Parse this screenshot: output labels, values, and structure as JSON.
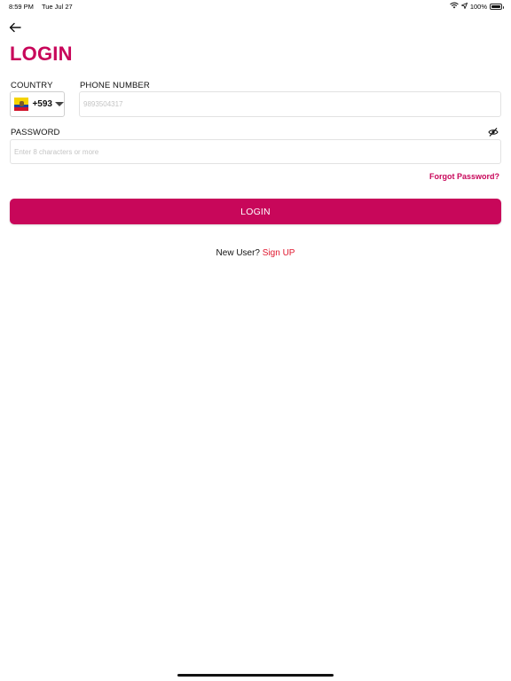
{
  "status_bar": {
    "time": "8:59 PM",
    "date": "Tue Jul 27",
    "battery_text": "100%",
    "battery_level": 1.0,
    "icons": [
      "wifi-icon",
      "location-icon",
      "battery-icon"
    ]
  },
  "header": {
    "back_icon": "arrow-left-icon",
    "title": "LOGIN"
  },
  "form": {
    "country_label": "COUNTRY",
    "country_flag": "ecuador-flag",
    "country_code": "+593",
    "phone_label": "PHONE NUMBER",
    "phone_placeholder": "9893504317",
    "password_label": "PASSWORD",
    "password_placeholder": "Enter 8 characters or more",
    "password_toggle_icon": "eye-off-icon",
    "forgot_password": "Forgot Password?",
    "login_button": "LOGIN"
  },
  "footer": {
    "new_user_text": "New User?",
    "signup_text": "Sign UP"
  },
  "colors": {
    "brand": "#c8075a",
    "signup_link": "#e0162d"
  }
}
